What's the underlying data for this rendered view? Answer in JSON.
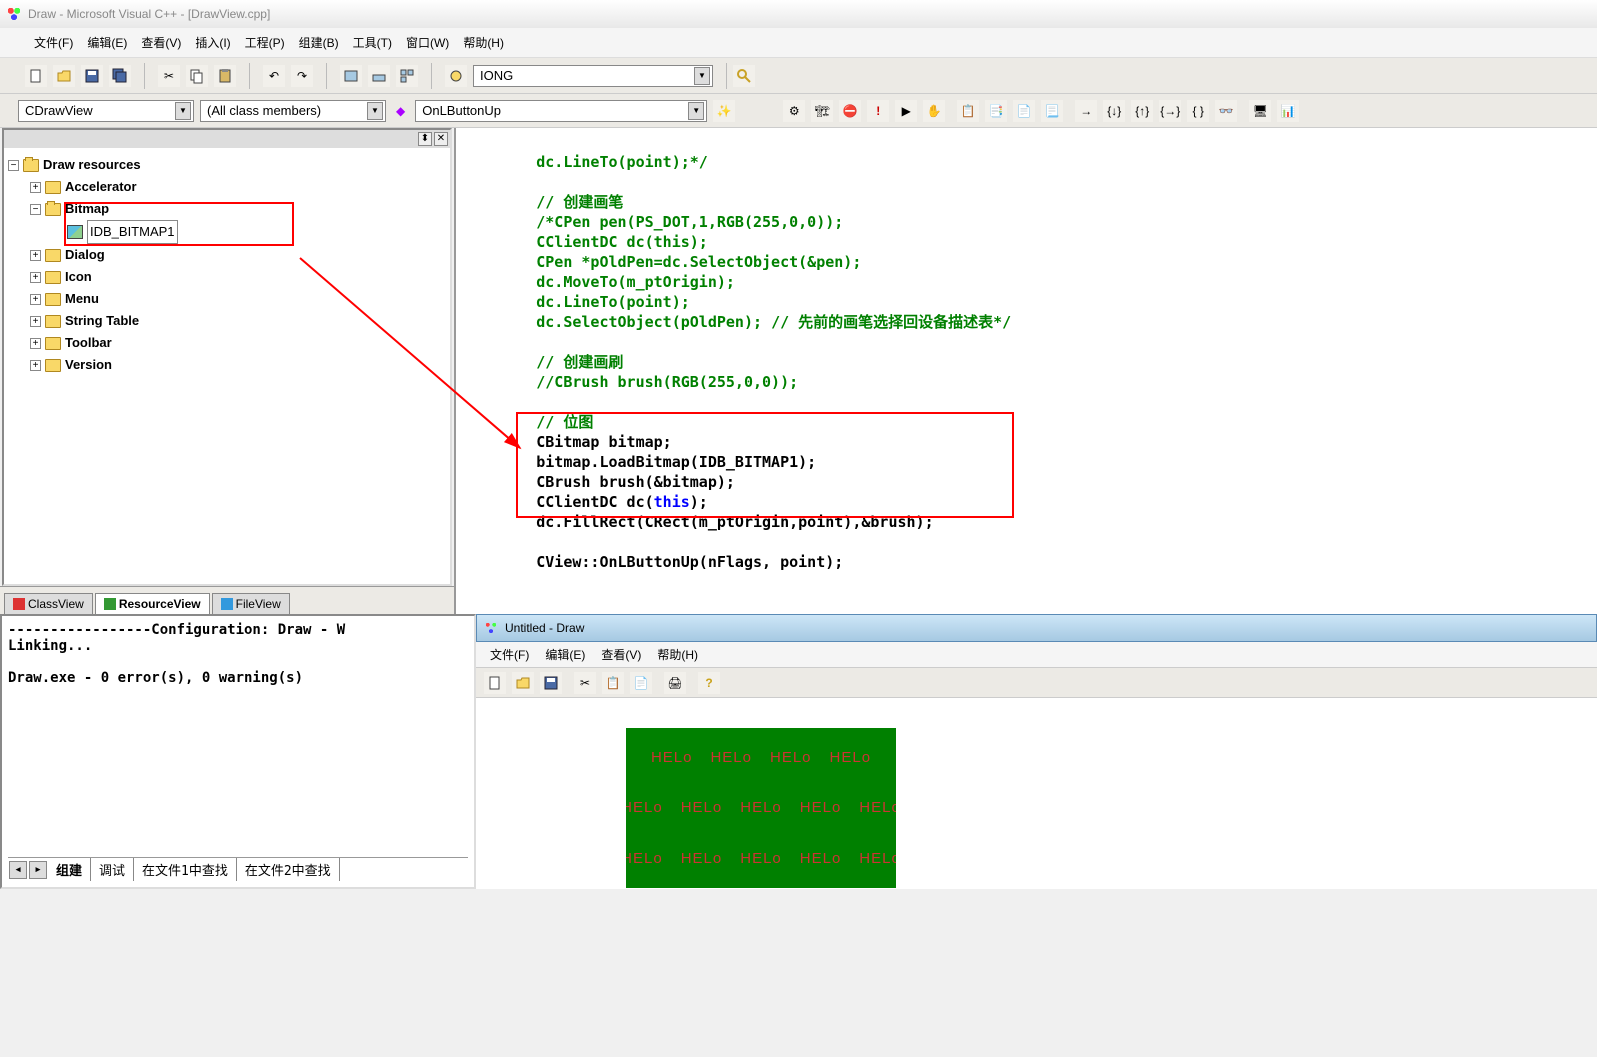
{
  "window": {
    "title": "Draw - Microsoft Visual C++ - [DrawView.cpp]"
  },
  "menu": {
    "file": "文件(F)",
    "edit": "编辑(E)",
    "view": "查看(V)",
    "insert": "插入(I)",
    "project": "工程(P)",
    "build": "组建(B)",
    "tools": "工具(T)",
    "window": "窗口(W)",
    "help": "帮助(H)"
  },
  "toolbar": {
    "find_combo": "IONG"
  },
  "nav": {
    "class_combo": "CDrawView",
    "member_combo": "(All class members)",
    "func_combo": "OnLButtonUp"
  },
  "tree": {
    "root": "Draw resources",
    "items": [
      "Accelerator",
      "Bitmap",
      "Dialog",
      "Icon",
      "Menu",
      "String Table",
      "Toolbar",
      "Version"
    ],
    "bitmap_child": "IDB_BITMAP1"
  },
  "left_tabs": {
    "class": "ClassView",
    "resource": "ResourceView",
    "file": "FileView"
  },
  "code": {
    "l1": "dc.LineTo(point);*/",
    "l2": "// 创建画笔",
    "l3": "/*CPen pen(PS_DOT,1,RGB(255,0,0));",
    "l4": "CClientDC dc(this);",
    "l5": "CPen *pOldPen=dc.SelectObject(&pen);",
    "l6": "dc.MoveTo(m_ptOrigin);",
    "l7": "dc.LineTo(point);",
    "l8a": "dc.SelectObject(pOldPen); ",
    "l8b": "// 先前的画笔选择回设备描述表*/",
    "l9": "// 创建画刷",
    "l10": "//CBrush brush(RGB(255,0,0));",
    "l11": "// 位图",
    "l12": "CBitmap bitmap;",
    "l13": "bitmap.LoadBitmap(IDB_BITMAP1);",
    "l14": "CBrush brush(&bitmap);",
    "l15a": "CClientDC dc(",
    "l15b": "this",
    "l15c": ");",
    "l16": "dc.FillRect(CRect(m_ptOrigin,point),&brush);",
    "l17": "CView::OnLButtonUp(nFlags, point);"
  },
  "output": {
    "cfg_line": "-----------------Configuration: Draw - W",
    "linking": "Linking...",
    "result": "Draw.exe - 0 error(s), 0 warning(s)",
    "tabs": {
      "build": "组建",
      "debug": "调试",
      "find1": "在文件1中查找",
      "find2": "在文件2中查找"
    }
  },
  "child": {
    "title": "Untitled - Draw",
    "menu": {
      "file": "文件(F)",
      "edit": "编辑(E)",
      "view": "查看(V)",
      "help": "帮助(H)"
    },
    "hello": "HELo"
  }
}
